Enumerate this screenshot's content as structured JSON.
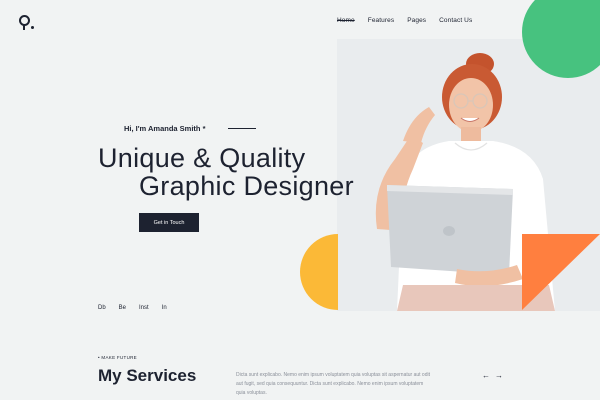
{
  "header": {
    "logo_icon": "logo-glyph",
    "nav": [
      "Home",
      "Features",
      "Pages",
      "Contact Us"
    ],
    "active_nav": "Home",
    "search_icon": "search-icon"
  },
  "hero": {
    "greeting": "Hi, I'm Amanda Smith *",
    "headline_line1": "Unique & Quality",
    "headline_line2": "Graphic Designer",
    "cta_label": "Get in Touch"
  },
  "socials": [
    "Db",
    "Be",
    "Inst",
    "In"
  ],
  "services": {
    "kicker": "• MAKE FUTURE",
    "title": "My Services",
    "description": "Dicta sunt explicabo. Nemo enim ipsum voluptatem quia voluptas sit aspernatur aut odit aut fugit, sed quia consequuntur. Dicta sunt explicabo. Nemo enim ipsum voluptatem quia voluptas.",
    "prev_icon": "arrow-left-icon",
    "next_icon": "arrow-right-icon"
  },
  "colors": {
    "dark": "#1d2230",
    "green": "#47c27f",
    "yellow": "#fbb937",
    "orange": "#ff7f3f",
    "background": "#f1f3f3"
  }
}
